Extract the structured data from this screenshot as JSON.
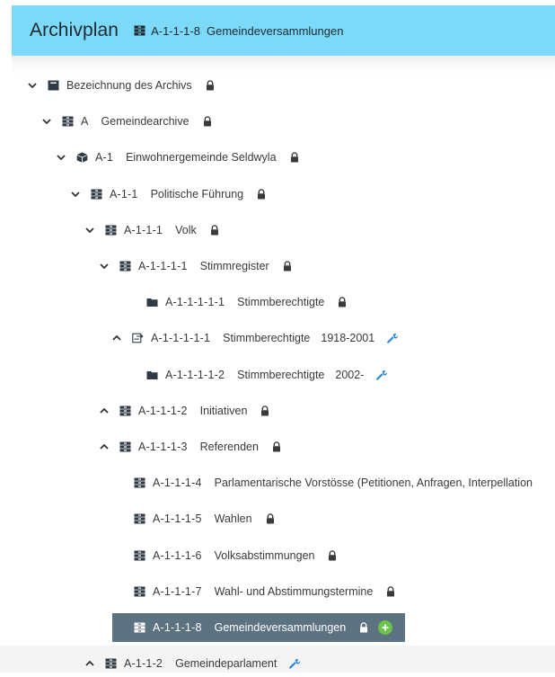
{
  "header": {
    "title": "Archivplan",
    "crumb_code": "A-1-1-1-8",
    "crumb_label": "Gemeindeversammlungen"
  },
  "colors": {
    "header_bg": "#7dd9f8",
    "selected_bg": "#5c7281",
    "wrench": "#2a86d9",
    "add": "#6cc24a"
  },
  "tree": [
    {
      "code": "",
      "label": "Bezeichnung des Archivs",
      "extra": "",
      "chevron": "down",
      "icon": "archive-root-icon",
      "badge": "lock"
    },
    {
      "code": "A",
      "label": "Gemeindearchive",
      "extra": "",
      "chevron": "down",
      "icon": "drawer-icon",
      "badge": "lock"
    },
    {
      "code": "A-1",
      "label": "Einwohnergemeinde Seldwyla",
      "extra": "",
      "chevron": "down",
      "icon": "box-icon",
      "badge": "lock"
    },
    {
      "code": "A-1-1",
      "label": "Politische Führung",
      "extra": "",
      "chevron": "down",
      "icon": "drawer-icon",
      "badge": "lock"
    },
    {
      "code": "A-1-1-1",
      "label": "Volk",
      "extra": "",
      "chevron": "down",
      "icon": "drawer-icon",
      "badge": "lock"
    },
    {
      "code": "A-1-1-1-1",
      "label": "Stimmregister",
      "extra": "",
      "chevron": "down",
      "icon": "drawer-icon",
      "badge": "lock"
    },
    {
      "code": "A-1-1-1-1-1",
      "label": "Stimmberechtigte",
      "extra": "",
      "chevron": "none",
      "icon": "folder-icon",
      "badge": "lock"
    },
    {
      "code": "A-1-1-1-1-1",
      "label": "Stimmberechtigte",
      "extra": "1918-2001",
      "chevron": "up",
      "icon": "dossier-icon",
      "badge": "wrench"
    },
    {
      "code": "A-1-1-1-1-2",
      "label": "Stimmberechtigte",
      "extra": "2002-",
      "chevron": "none",
      "icon": "folder-icon",
      "badge": "wrench"
    },
    {
      "code": "A-1-1-1-2",
      "label": "Initiativen",
      "extra": "",
      "chevron": "up",
      "icon": "drawer-icon",
      "badge": "lock"
    },
    {
      "code": "A-1-1-1-3",
      "label": "Referenden",
      "extra": "",
      "chevron": "up",
      "icon": "drawer-icon",
      "badge": "lock"
    },
    {
      "code": "A-1-1-1-4",
      "label": "Parlamentarische Vorstösse (Petitionen, Anfragen, Interpellation",
      "extra": "",
      "chevron": "none",
      "icon": "drawer-icon",
      "badge": "none"
    },
    {
      "code": "A-1-1-1-5",
      "label": "Wahlen",
      "extra": "",
      "chevron": "none",
      "icon": "drawer-icon",
      "badge": "lock"
    },
    {
      "code": "A-1-1-1-6",
      "label": "Volksabstimmungen",
      "extra": "",
      "chevron": "none",
      "icon": "drawer-icon",
      "badge": "lock"
    },
    {
      "code": "A-1-1-1-7",
      "label": "Wahl- und Abstimmungstermine",
      "extra": "",
      "chevron": "none",
      "icon": "drawer-icon",
      "badge": "lock"
    },
    {
      "code": "A-1-1-1-8",
      "label": "Gemeindeversammlungen",
      "extra": "",
      "chevron": "none",
      "icon": "drawer-icon",
      "badge": "lock",
      "selected": true,
      "add": true
    },
    {
      "code": "A-1-1-2",
      "label": "Gemeindeparlament",
      "extra": "",
      "chevron": "up",
      "icon": "drawer-icon",
      "badge": "wrench"
    }
  ]
}
